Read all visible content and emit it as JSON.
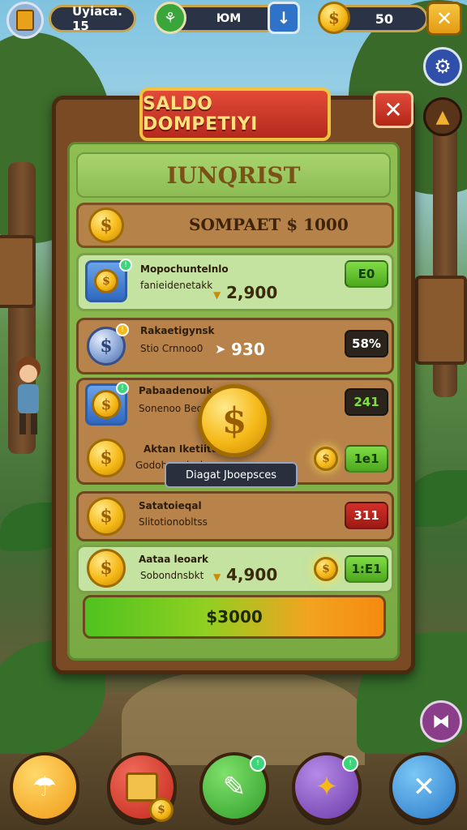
{
  "topbar": {
    "profile_label": "Uyiaca. 15",
    "center_label": "ЮМ",
    "coins_value": "50"
  },
  "dialog": {
    "title": "SALDO DOMPETIYI",
    "subtitle": "IUNQRIST",
    "total_label": "SOMPAET $ 1000",
    "rows": [
      {
        "name": "Mopochuntelnlo",
        "desc": "fanieidenetakk",
        "amount": "2,900",
        "badge": "E0",
        "badge_color": "green"
      },
      {
        "name": "Rakaetigynsk",
        "desc": "Stio Crnnoo0",
        "amount": "930",
        "badge": "58%",
        "badge_color": "dark"
      },
      {
        "name": "Pabaadenouk",
        "desc": "Sonenoo Beoti",
        "amount": "",
        "badge": "241",
        "badge_color": "dark"
      },
      {
        "name": "Aktan Iketiitt",
        "desc": "Godoh nraisebs",
        "amount": "",
        "badge": "1e1",
        "badge_color": "green"
      },
      {
        "name": "Satatoieqal",
        "desc": "Slitotionobltss",
        "amount": "",
        "badge": "311",
        "badge_color": "red"
      },
      {
        "name": "Aataa leoark",
        "desc": "Sobondnsbkt",
        "amount": "4,900",
        "badge": "1:E1",
        "badge_color": "green"
      }
    ],
    "tooltip": "Diagat Jboepsces",
    "progress_label": "$3000"
  },
  "colors": {
    "panel_wood": "#7a4a24",
    "panel_green": "#8fbf52",
    "title_red": "#c8321f",
    "gold": "#f5b918"
  }
}
